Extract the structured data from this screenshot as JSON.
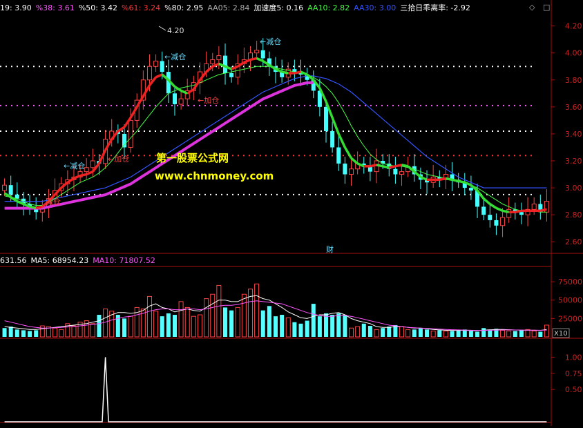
{
  "header": {
    "items": [
      {
        "label": "19: 3.90",
        "color": "#ffffff"
      },
      {
        "label": "%38: 3.61",
        "color": "#ff55ff"
      },
      {
        "label": "%50: 3.42",
        "color": "#ffffff"
      },
      {
        "label": "%61: 3.24",
        "color": "#ff3333"
      },
      {
        "label": "%80: 2.95",
        "color": "#ffffff"
      },
      {
        "label": "AA05: 2.84",
        "color": "#aaaaaa"
      },
      {
        "label": "加速度5: 0.16",
        "color": "#ffffff"
      },
      {
        "label": "AA10: 2.82",
        "color": "#44ff44"
      },
      {
        "label": "AA30: 3.00",
        "color": "#3355ff"
      },
      {
        "label": "三拾日乖离率: -2.92",
        "color": "#ffffff"
      }
    ]
  },
  "volume_header": {
    "items": [
      {
        "label": "631.56",
        "color": "#ffffff"
      },
      {
        "label": "MA5: 68954.23",
        "color": "#ffffff"
      },
      {
        "label": "MA10: 71807.52",
        "color": "#ff55ff"
      }
    ]
  },
  "watermark": {
    "line1": "第一股票公式网",
    "line2": "www.chnmoney.com"
  },
  "corner_icons": {
    "diamond": "◇",
    "box": "□"
  },
  "chart_data": [
    {
      "type": "candlestick",
      "ylim": [
        2.55,
        4.28
      ],
      "yticks": [
        "4.20",
        "4.00",
        "3.80",
        "3.60",
        "3.40",
        "3.20",
        "3.00",
        "2.80",
        "2.60"
      ],
      "ytick_values": [
        4.2,
        4.0,
        3.8,
        3.6,
        3.4,
        3.2,
        3.0,
        2.8,
        2.6
      ],
      "hlines": [
        {
          "value": 3.9,
          "color": "#ffffff"
        },
        {
          "value": 3.61,
          "color": "#ff55ff"
        },
        {
          "value": 3.42,
          "color": "#ffffff"
        },
        {
          "value": 3.24,
          "color": "#ff3333"
        },
        {
          "value": 2.95,
          "color": "#ffffff"
        }
      ],
      "series": [
        {
          "name": "AA05",
          "color": "#e0d060",
          "values": [
            2.96,
            2.93,
            2.9,
            2.88,
            2.86,
            2.85,
            2.86,
            2.9,
            2.95,
            3.0,
            3.04,
            3.07,
            3.09,
            3.1,
            3.12,
            3.18,
            3.28,
            3.36,
            3.42,
            3.45,
            3.52,
            3.6,
            3.68,
            3.76,
            3.82,
            3.84,
            3.8,
            3.75,
            3.72,
            3.7,
            3.73,
            3.8,
            3.86,
            3.9,
            3.92,
            3.9,
            3.88,
            3.9,
            3.93,
            3.95,
            3.96,
            3.94,
            3.91,
            3.88,
            3.86,
            3.85,
            3.85,
            3.86,
            3.84,
            3.8,
            3.74,
            3.64,
            3.52,
            3.4,
            3.3,
            3.22,
            3.18,
            3.16,
            3.16,
            3.17,
            3.16,
            3.15,
            3.16,
            3.17,
            3.16,
            3.12,
            3.08,
            3.06,
            3.06,
            3.06,
            3.07,
            3.06,
            3.05,
            3.04,
            3.02,
            2.98,
            2.92,
            2.88,
            2.85,
            2.83,
            2.82,
            2.82,
            2.83,
            2.83,
            2.83,
            2.83,
            2.84
          ]
        },
        {
          "name": "AA10",
          "color": "#44ff44",
          "values": [
            2.94,
            2.93,
            2.92,
            2.9,
            2.88,
            2.87,
            2.87,
            2.89,
            2.92,
            2.95,
            2.98,
            3.01,
            3.04,
            3.06,
            3.08,
            3.11,
            3.15,
            3.2,
            3.26,
            3.32,
            3.37,
            3.42,
            3.48,
            3.54,
            3.6,
            3.65,
            3.7,
            3.72,
            3.74,
            3.75,
            3.76,
            3.78,
            3.8,
            3.82,
            3.84,
            3.85,
            3.86,
            3.87,
            3.88,
            3.89,
            3.9,
            3.9,
            3.9,
            3.89,
            3.88,
            3.87,
            3.86,
            3.85,
            3.84,
            3.82,
            3.79,
            3.75,
            3.7,
            3.63,
            3.55,
            3.46,
            3.38,
            3.31,
            3.25,
            3.21,
            3.18,
            3.17,
            3.16,
            3.16,
            3.15,
            3.14,
            3.12,
            3.1,
            3.09,
            3.08,
            3.07,
            3.06,
            3.05,
            3.04,
            3.02,
            3.0,
            2.97,
            2.94,
            2.91,
            2.88,
            2.86,
            2.84,
            2.83,
            2.83,
            2.83,
            2.82,
            2.82
          ]
        },
        {
          "name": "AA30",
          "color": "#3355ff",
          "values": [
            2.9,
            2.9,
            2.9,
            2.9,
            2.9,
            2.9,
            2.9,
            2.91,
            2.92,
            2.93,
            2.94,
            2.95,
            2.96,
            2.97,
            2.98,
            2.99,
            3.0,
            3.02,
            3.04,
            3.06,
            3.08,
            3.11,
            3.14,
            3.17,
            3.2,
            3.23,
            3.26,
            3.29,
            3.32,
            3.35,
            3.38,
            3.41,
            3.44,
            3.47,
            3.5,
            3.53,
            3.56,
            3.59,
            3.62,
            3.65,
            3.68,
            3.71,
            3.73,
            3.75,
            3.77,
            3.79,
            3.81,
            3.82,
            3.83,
            3.83,
            3.82,
            3.81,
            3.79,
            3.77,
            3.74,
            3.71,
            3.67,
            3.63,
            3.59,
            3.55,
            3.51,
            3.47,
            3.43,
            3.39,
            3.35,
            3.31,
            3.27,
            3.23,
            3.2,
            3.17,
            3.14,
            3.11,
            3.08,
            3.06,
            3.04,
            3.02,
            3.0,
            3.0,
            3.0,
            3.0,
            3.0,
            3.0,
            3.0,
            3.0,
            3.0,
            3.0,
            3.0
          ]
        }
      ],
      "closes": [
        3.02,
        2.95,
        2.92,
        2.88,
        2.84,
        2.82,
        2.86,
        2.92,
        2.98,
        3.03,
        3.06,
        3.08,
        3.12,
        3.15,
        3.2,
        3.18,
        3.36,
        3.42,
        3.4,
        3.3,
        3.5,
        3.65,
        3.8,
        3.9,
        3.94,
        3.86,
        3.7,
        3.62,
        3.66,
        3.72,
        3.78,
        3.86,
        3.92,
        3.95,
        3.98,
        3.85,
        3.82,
        3.92,
        3.95,
        4.0,
        4.02,
        3.96,
        3.9,
        3.86,
        3.82,
        3.88,
        3.86,
        3.84,
        3.8,
        3.72,
        3.6,
        3.42,
        3.3,
        3.18,
        3.1,
        3.14,
        3.18,
        3.16,
        3.12,
        3.2,
        3.18,
        3.14,
        3.1,
        3.12,
        3.16,
        3.1,
        3.06,
        3.04,
        3.08,
        3.06,
        3.1,
        3.06,
        3.04,
        3.0,
        2.98,
        2.86,
        2.8,
        2.76,
        2.72,
        2.78,
        2.84,
        2.82,
        2.8,
        2.84,
        2.88,
        2.82,
        2.9
      ],
      "candle_up": [
        true,
        false,
        false,
        false,
        false,
        false,
        true,
        true,
        true,
        true,
        true,
        true,
        true,
        true,
        true,
        false,
        true,
        true,
        false,
        false,
        true,
        true,
        true,
        true,
        true,
        false,
        false,
        false,
        true,
        true,
        true,
        true,
        true,
        true,
        true,
        false,
        false,
        true,
        true,
        true,
        true,
        false,
        false,
        false,
        false,
        true,
        false,
        false,
        false,
        false,
        false,
        false,
        false,
        false,
        false,
        true,
        true,
        false,
        false,
        true,
        false,
        false,
        false,
        true,
        true,
        false,
        false,
        false,
        true,
        false,
        true,
        false,
        false,
        false,
        false,
        false,
        false,
        false,
        false,
        true,
        true,
        false,
        false,
        true,
        true,
        false,
        true
      ],
      "peak_label": "4.20",
      "annotations": [
        {
          "text": "←减仓",
          "color": "#66ddff"
        },
        {
          "text": "←加仓",
          "color": "#ff4444"
        },
        {
          "text": "←减仓",
          "color": "#66ddff"
        },
        {
          "text": "←加仓",
          "color": "#ff4444"
        },
        {
          "text": "←减仓",
          "color": "#66ddff"
        },
        {
          "text": "减仓",
          "color": "#ff4444"
        },
        {
          "text": "财",
          "color": "#66ddff"
        }
      ]
    },
    {
      "type": "bar",
      "ylim": [
        0,
        92000
      ],
      "yticks": [
        "75000",
        "50000",
        "25000"
      ],
      "ytick_values": [
        75000,
        50000,
        25000
      ],
      "scale_label": "X10",
      "values": [
        12000,
        14000,
        10000,
        9000,
        8000,
        9000,
        15000,
        14000,
        12000,
        10000,
        18000,
        15000,
        20000,
        22000,
        18000,
        30000,
        38000,
        35000,
        30000,
        25000,
        28000,
        40000,
        38000,
        55000,
        35000,
        28000,
        32000,
        30000,
        48000,
        40000,
        28000,
        30000,
        52000,
        58000,
        70000,
        40000,
        36000,
        40000,
        58000,
        65000,
        72000,
        36000,
        42000,
        28000,
        30000,
        26000,
        20000,
        18000,
        22000,
        45000,
        28000,
        32000,
        30000,
        32000,
        30000,
        12000,
        14000,
        18000,
        15000,
        10000,
        12000,
        14000,
        16000,
        14000,
        10000,
        10000,
        12000,
        10000,
        8000,
        9000,
        8000,
        8000,
        9000,
        10000,
        8000,
        7000,
        12000,
        10000,
        11000,
        9000,
        8000,
        8000,
        9000,
        10000,
        8000,
        7000,
        16000
      ],
      "up": [
        false,
        false,
        false,
        false,
        false,
        false,
        true,
        true,
        true,
        true,
        true,
        true,
        true,
        true,
        true,
        false,
        true,
        true,
        false,
        false,
        true,
        true,
        true,
        true,
        true,
        false,
        false,
        false,
        true,
        true,
        true,
        true,
        true,
        true,
        true,
        false,
        false,
        true,
        true,
        true,
        true,
        false,
        false,
        false,
        false,
        true,
        false,
        false,
        false,
        false,
        false,
        false,
        false,
        false,
        false,
        true,
        true,
        false,
        false,
        true,
        false,
        false,
        false,
        true,
        true,
        false,
        false,
        false,
        true,
        false,
        true,
        false,
        false,
        false,
        false,
        false,
        false,
        false,
        false,
        true,
        true,
        false,
        false,
        true,
        true,
        false,
        true
      ],
      "ma5": [
        14000,
        13000,
        12000,
        11000,
        10000,
        10000,
        11000,
        12000,
        13000,
        14000,
        15000,
        16000,
        17000,
        18000,
        20000,
        22000,
        26000,
        30000,
        33000,
        33000,
        32000,
        33000,
        36000,
        42000,
        45000,
        40000,
        38000,
        34000,
        36000,
        38000,
        36000,
        35000,
        40000,
        45000,
        50000,
        50000,
        48000,
        48000,
        52000,
        55000,
        56000,
        52000,
        50000,
        45000,
        40000,
        34000,
        30000,
        26000,
        25000,
        28000,
        30000,
        30000,
        32000,
        33000,
        30000,
        25000,
        22000,
        20000,
        18000,
        14000,
        13000,
        13000,
        14000,
        14000,
        13000,
        12000,
        12000,
        11000,
        10000,
        9500,
        9000,
        8800,
        8800,
        9000,
        8500,
        8400,
        9200,
        9600,
        10000,
        10000,
        9800,
        9400,
        9200,
        9000,
        9000,
        8800,
        10000
      ],
      "ma10": [
        22000,
        20000,
        18000,
        16000,
        14000,
        13000,
        12000,
        12000,
        12500,
        13000,
        13500,
        14000,
        15000,
        16000,
        17000,
        18000,
        20000,
        23000,
        25000,
        27000,
        28000,
        30000,
        32000,
        35000,
        37000,
        38000,
        38000,
        37000,
        37000,
        38000,
        38000,
        37000,
        38000,
        40000,
        42000,
        43000,
        43000,
        44000,
        46000,
        48000,
        49000,
        48000,
        47000,
        46000,
        45000,
        42000,
        39000,
        36000,
        33000,
        31000,
        29000,
        28000,
        28000,
        29000,
        29000,
        28000,
        26000,
        24000,
        22000,
        20000,
        18000,
        16000,
        15000,
        14000,
        13000,
        12500,
        12000,
        11500,
        11000,
        10500,
        10000,
        9800,
        9500,
        9300,
        9000,
        8800,
        8800,
        9000,
        9200,
        9400,
        9500,
        9400,
        9300,
        9200,
        9100,
        9000,
        9200
      ]
    },
    {
      "type": "line",
      "ylim": [
        0,
        1.25
      ],
      "yticks": [
        "1.00",
        "0.75",
        "0.50"
      ],
      "ytick_values": [
        1.0,
        0.75,
        0.5
      ],
      "values": [
        0,
        0,
        0,
        0,
        0,
        0,
        0,
        0,
        0,
        0,
        0,
        0,
        0,
        0,
        0,
        0,
        1,
        0,
        0,
        0,
        0,
        0,
        0,
        0,
        0,
        0,
        0,
        0,
        0,
        0,
        0,
        0,
        0,
        0,
        0,
        0,
        0,
        0,
        0,
        0,
        0,
        0,
        0,
        0,
        0,
        0,
        0,
        0,
        0,
        0,
        0,
        0,
        0,
        0,
        0,
        0,
        0,
        0,
        0,
        0,
        0,
        0,
        0,
        0,
        0,
        0,
        0,
        0,
        0,
        0,
        0,
        0,
        0,
        0,
        0,
        0,
        0,
        0,
        0,
        0,
        0,
        0,
        0,
        0,
        0,
        0,
        0
      ]
    }
  ]
}
